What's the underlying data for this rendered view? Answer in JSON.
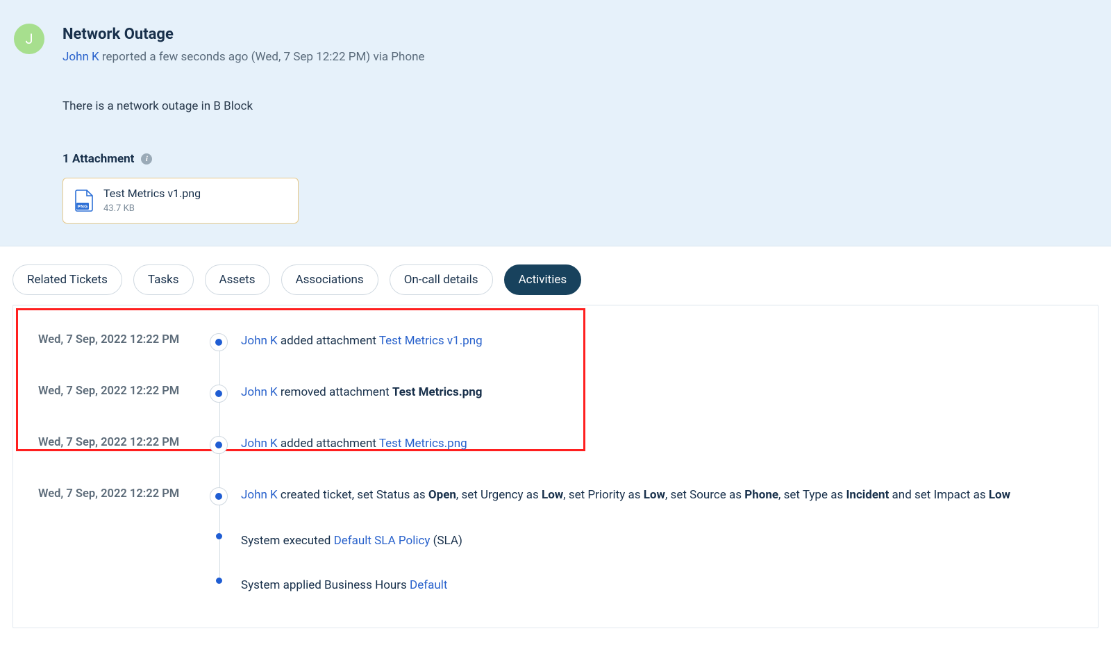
{
  "header": {
    "avatar_initial": "J",
    "title": "Network Outage",
    "reporter": "John K",
    "reported_text_prefix": " reported a few seconds ago ",
    "reported_at": "(Wed, 7 Sep 12:22 PM)",
    "reported_via": " via Phone",
    "description": "There is a network outage in B Block",
    "attachments_label": "1 Attachment",
    "attachment": {
      "name": "Test Metrics v1.png",
      "size": "43.7 KB",
      "badge": "PNG"
    }
  },
  "tabs": {
    "related": "Related Tickets",
    "tasks": "Tasks",
    "assets": "Assets",
    "associations": "Associations",
    "oncall": "On-call details",
    "activities": "Activities"
  },
  "activities": [
    {
      "time": "Wed, 7 Sep, 2022 12:22 PM",
      "style": "big",
      "parts": [
        {
          "type": "link",
          "text": "John K"
        },
        {
          "type": "text",
          "text": " added attachment "
        },
        {
          "type": "filelink",
          "text": "Test Metrics v1.png"
        }
      ]
    },
    {
      "time": "Wed, 7 Sep, 2022 12:22 PM",
      "style": "big",
      "parts": [
        {
          "type": "link",
          "text": "John K"
        },
        {
          "type": "text",
          "text": " removed attachment "
        },
        {
          "type": "bold",
          "text": "Test Metrics.png"
        }
      ]
    },
    {
      "time": "Wed, 7 Sep, 2022 12:22 PM",
      "style": "big",
      "parts": [
        {
          "type": "link",
          "text": "John K"
        },
        {
          "type": "text",
          "text": " added attachment "
        },
        {
          "type": "filelink",
          "text": "Test Metrics.png"
        }
      ]
    },
    {
      "time": "Wed, 7 Sep, 2022 12:22 PM",
      "style": "big",
      "parts": [
        {
          "type": "link",
          "text": "John K"
        },
        {
          "type": "text",
          "text": " created ticket, set Status as "
        },
        {
          "type": "bold",
          "text": "Open"
        },
        {
          "type": "text",
          "text": ", set Urgency as "
        },
        {
          "type": "bold",
          "text": "Low"
        },
        {
          "type": "text",
          "text": ", set Priority as "
        },
        {
          "type": "bold",
          "text": "Low"
        },
        {
          "type": "text",
          "text": ", set Source as "
        },
        {
          "type": "bold",
          "text": "Phone"
        },
        {
          "type": "text",
          "text": ", set Type as "
        },
        {
          "type": "bold",
          "text": "Incident"
        },
        {
          "type": "text",
          "text": " and set Impact as "
        },
        {
          "type": "bold",
          "text": "Low"
        }
      ]
    },
    {
      "time": "",
      "style": "small",
      "parts": [
        {
          "type": "text",
          "text": "System executed "
        },
        {
          "type": "link",
          "text": "Default SLA Policy"
        },
        {
          "type": "text",
          "text": " (SLA)"
        }
      ]
    },
    {
      "time": "",
      "style": "small",
      "parts": [
        {
          "type": "text",
          "text": "System applied Business Hours "
        },
        {
          "type": "link",
          "text": "Default"
        }
      ]
    }
  ]
}
